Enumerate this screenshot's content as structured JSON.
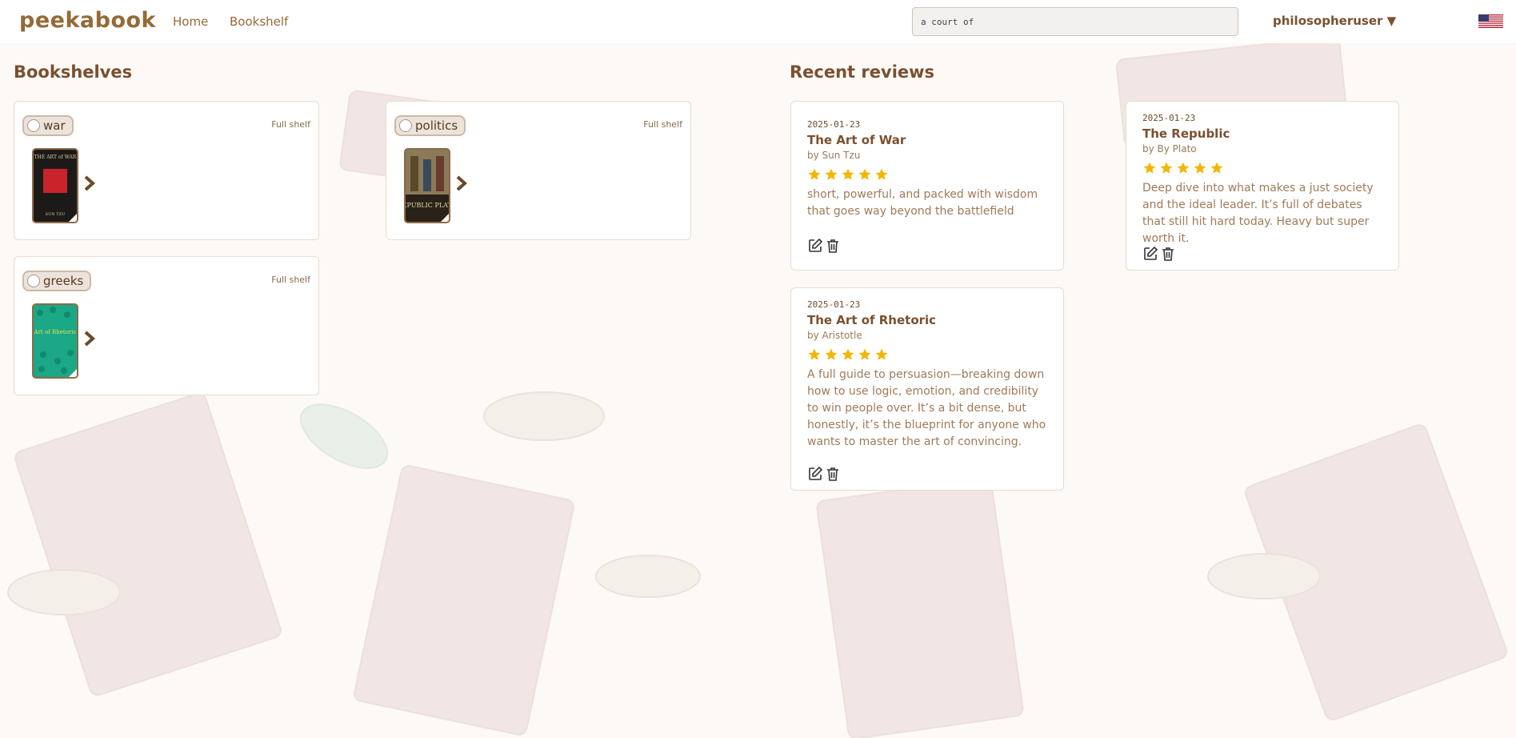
{
  "app": {
    "logo": "peekabook"
  },
  "nav": {
    "home": "Home",
    "bookshelf": "Bookshelf"
  },
  "search": {
    "value": "a court of"
  },
  "user": {
    "label": "philosopheruser ▼",
    "flag": "us-flag-icon"
  },
  "bookshelves": {
    "title": "Bookshelves",
    "shelves": [
      {
        "name": "war",
        "full_shelf": "Full shelf",
        "book_cover_title": "THE ART of WAR",
        "book_cover_author": "SUN TZU"
      },
      {
        "name": "politics",
        "full_shelf": "Full shelf",
        "book_cover_title": "REPUBLIC PLATO"
      },
      {
        "name": "greeks",
        "full_shelf": "Full shelf",
        "book_cover_title": "Art of Rhetoric"
      }
    ]
  },
  "reviews": {
    "title": "Recent reviews",
    "items": [
      {
        "date": "2025-01-23",
        "title": "The Art of War",
        "author": "by Sun Tzu",
        "rating": 5,
        "text": "short, powerful, and packed with wisdom that goes way beyond the battlefield"
      },
      {
        "date": "2025-01-23",
        "title": "The Republic",
        "author": "by By Plato",
        "rating": 5,
        "text": "Deep dive into what makes a just society and the ideal leader. It’s full of debates that still hit hard today. Heavy but super worth it."
      },
      {
        "date": "2025-01-23",
        "title": "The Art of Rhetoric",
        "author": "by Aristotle",
        "rating": 5,
        "text": "A full guide to persuasion—breaking down how to use logic, emotion, and credibility to win people over. It’s a bit dense, but honestly, it’s the blueprint for anyone who wants to master the art of convincing."
      }
    ]
  },
  "colors": {
    "star": "#f2b705",
    "brand": "#946a37"
  }
}
